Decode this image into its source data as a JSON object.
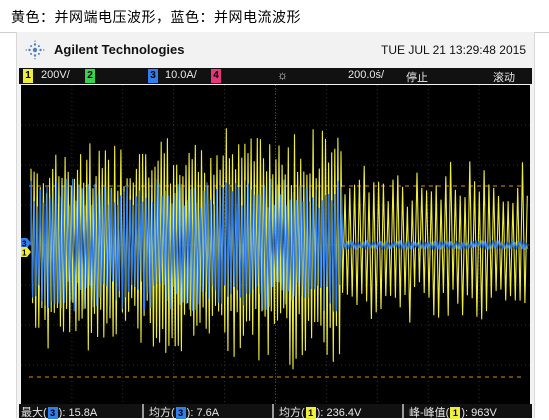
{
  "caption": "黄色：并网端电压波形，蓝色：并网电流波形",
  "brand": {
    "name": "Agilent Technologies",
    "logo_icon": "agilent-spark-icon"
  },
  "datetime": "TUE JUL 21 13:29:48 2015",
  "status_bar": {
    "ch1_num": "1",
    "ch1_scale": "200V/",
    "ch2_num": "2",
    "ch3_num": "3",
    "ch3_scale": "10.0A/",
    "ch4_num": "4",
    "trigger_icon": "trigger-sun-icon",
    "timebase": "200.0ṡ/",
    "run_state": "停止",
    "mode": "滚动"
  },
  "colors": {
    "ch1": "#f0ee3c",
    "ch2": "#36d44a",
    "ch3": "#2f7ff0",
    "ch4": "#e8367a",
    "grid": "#3c3c3c",
    "limit_line": "#d88a20",
    "screen_bg": "#000000"
  },
  "screen": {
    "ch3_marker": "3",
    "ch1_marker": "1",
    "limit_lines": 2,
    "transition_fraction": 0.63,
    "voltage_amplitude_before": 0.72,
    "voltage_amplitude_after": 0.55,
    "current_amplitude_before": 0.38,
    "current_amplitude_after": 0.03
  },
  "measurements": [
    {
      "label": "最大",
      "channel": "3",
      "value": "15.8A"
    },
    {
      "label": "均方",
      "channel": "3",
      "value": "7.6A"
    },
    {
      "label": "均方",
      "channel": "1",
      "value": "236.4V"
    },
    {
      "label": "峰-峰值",
      "channel": "1",
      "value": "963V"
    }
  ]
}
